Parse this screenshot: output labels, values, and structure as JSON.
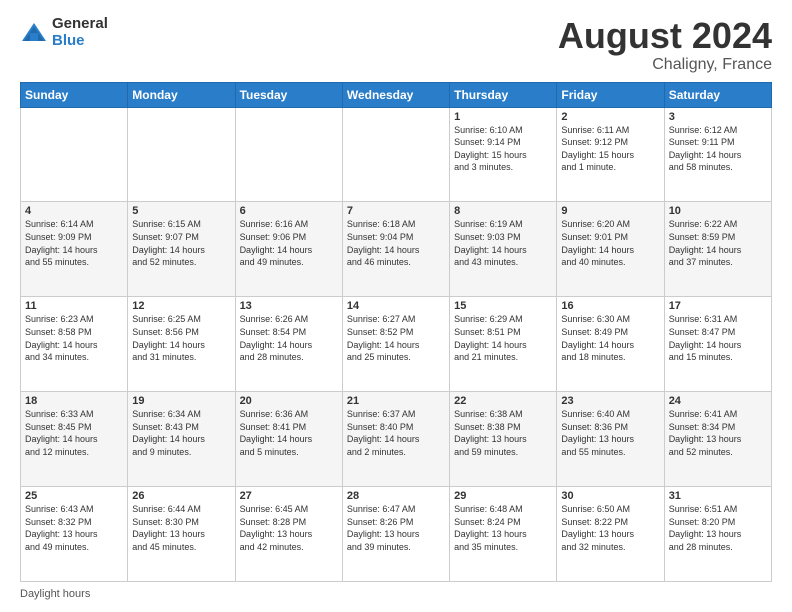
{
  "logo": {
    "general": "General",
    "blue": "Blue"
  },
  "header": {
    "month_year": "August 2024",
    "location": "Chaligny, France"
  },
  "days_of_week": [
    "Sunday",
    "Monday",
    "Tuesday",
    "Wednesday",
    "Thursday",
    "Friday",
    "Saturday"
  ],
  "footer": {
    "daylight_hours": "Daylight hours"
  },
  "weeks": [
    {
      "days": [
        {
          "number": "",
          "info": ""
        },
        {
          "number": "",
          "info": ""
        },
        {
          "number": "",
          "info": ""
        },
        {
          "number": "",
          "info": ""
        },
        {
          "number": "1",
          "info": "Sunrise: 6:10 AM\nSunset: 9:14 PM\nDaylight: 15 hours\nand 3 minutes."
        },
        {
          "number": "2",
          "info": "Sunrise: 6:11 AM\nSunset: 9:12 PM\nDaylight: 15 hours\nand 1 minute."
        },
        {
          "number": "3",
          "info": "Sunrise: 6:12 AM\nSunset: 9:11 PM\nDaylight: 14 hours\nand 58 minutes."
        }
      ]
    },
    {
      "days": [
        {
          "number": "4",
          "info": "Sunrise: 6:14 AM\nSunset: 9:09 PM\nDaylight: 14 hours\nand 55 minutes."
        },
        {
          "number": "5",
          "info": "Sunrise: 6:15 AM\nSunset: 9:07 PM\nDaylight: 14 hours\nand 52 minutes."
        },
        {
          "number": "6",
          "info": "Sunrise: 6:16 AM\nSunset: 9:06 PM\nDaylight: 14 hours\nand 49 minutes."
        },
        {
          "number": "7",
          "info": "Sunrise: 6:18 AM\nSunset: 9:04 PM\nDaylight: 14 hours\nand 46 minutes."
        },
        {
          "number": "8",
          "info": "Sunrise: 6:19 AM\nSunset: 9:03 PM\nDaylight: 14 hours\nand 43 minutes."
        },
        {
          "number": "9",
          "info": "Sunrise: 6:20 AM\nSunset: 9:01 PM\nDaylight: 14 hours\nand 40 minutes."
        },
        {
          "number": "10",
          "info": "Sunrise: 6:22 AM\nSunset: 8:59 PM\nDaylight: 14 hours\nand 37 minutes."
        }
      ]
    },
    {
      "days": [
        {
          "number": "11",
          "info": "Sunrise: 6:23 AM\nSunset: 8:58 PM\nDaylight: 14 hours\nand 34 minutes."
        },
        {
          "number": "12",
          "info": "Sunrise: 6:25 AM\nSunset: 8:56 PM\nDaylight: 14 hours\nand 31 minutes."
        },
        {
          "number": "13",
          "info": "Sunrise: 6:26 AM\nSunset: 8:54 PM\nDaylight: 14 hours\nand 28 minutes."
        },
        {
          "number": "14",
          "info": "Sunrise: 6:27 AM\nSunset: 8:52 PM\nDaylight: 14 hours\nand 25 minutes."
        },
        {
          "number": "15",
          "info": "Sunrise: 6:29 AM\nSunset: 8:51 PM\nDaylight: 14 hours\nand 21 minutes."
        },
        {
          "number": "16",
          "info": "Sunrise: 6:30 AM\nSunset: 8:49 PM\nDaylight: 14 hours\nand 18 minutes."
        },
        {
          "number": "17",
          "info": "Sunrise: 6:31 AM\nSunset: 8:47 PM\nDaylight: 14 hours\nand 15 minutes."
        }
      ]
    },
    {
      "days": [
        {
          "number": "18",
          "info": "Sunrise: 6:33 AM\nSunset: 8:45 PM\nDaylight: 14 hours\nand 12 minutes."
        },
        {
          "number": "19",
          "info": "Sunrise: 6:34 AM\nSunset: 8:43 PM\nDaylight: 14 hours\nand 9 minutes."
        },
        {
          "number": "20",
          "info": "Sunrise: 6:36 AM\nSunset: 8:41 PM\nDaylight: 14 hours\nand 5 minutes."
        },
        {
          "number": "21",
          "info": "Sunrise: 6:37 AM\nSunset: 8:40 PM\nDaylight: 14 hours\nand 2 minutes."
        },
        {
          "number": "22",
          "info": "Sunrise: 6:38 AM\nSunset: 8:38 PM\nDaylight: 13 hours\nand 59 minutes."
        },
        {
          "number": "23",
          "info": "Sunrise: 6:40 AM\nSunset: 8:36 PM\nDaylight: 13 hours\nand 55 minutes."
        },
        {
          "number": "24",
          "info": "Sunrise: 6:41 AM\nSunset: 8:34 PM\nDaylight: 13 hours\nand 52 minutes."
        }
      ]
    },
    {
      "days": [
        {
          "number": "25",
          "info": "Sunrise: 6:43 AM\nSunset: 8:32 PM\nDaylight: 13 hours\nand 49 minutes."
        },
        {
          "number": "26",
          "info": "Sunrise: 6:44 AM\nSunset: 8:30 PM\nDaylight: 13 hours\nand 45 minutes."
        },
        {
          "number": "27",
          "info": "Sunrise: 6:45 AM\nSunset: 8:28 PM\nDaylight: 13 hours\nand 42 minutes."
        },
        {
          "number": "28",
          "info": "Sunrise: 6:47 AM\nSunset: 8:26 PM\nDaylight: 13 hours\nand 39 minutes."
        },
        {
          "number": "29",
          "info": "Sunrise: 6:48 AM\nSunset: 8:24 PM\nDaylight: 13 hours\nand 35 minutes."
        },
        {
          "number": "30",
          "info": "Sunrise: 6:50 AM\nSunset: 8:22 PM\nDaylight: 13 hours\nand 32 minutes."
        },
        {
          "number": "31",
          "info": "Sunrise: 6:51 AM\nSunset: 8:20 PM\nDaylight: 13 hours\nand 28 minutes."
        }
      ]
    }
  ]
}
